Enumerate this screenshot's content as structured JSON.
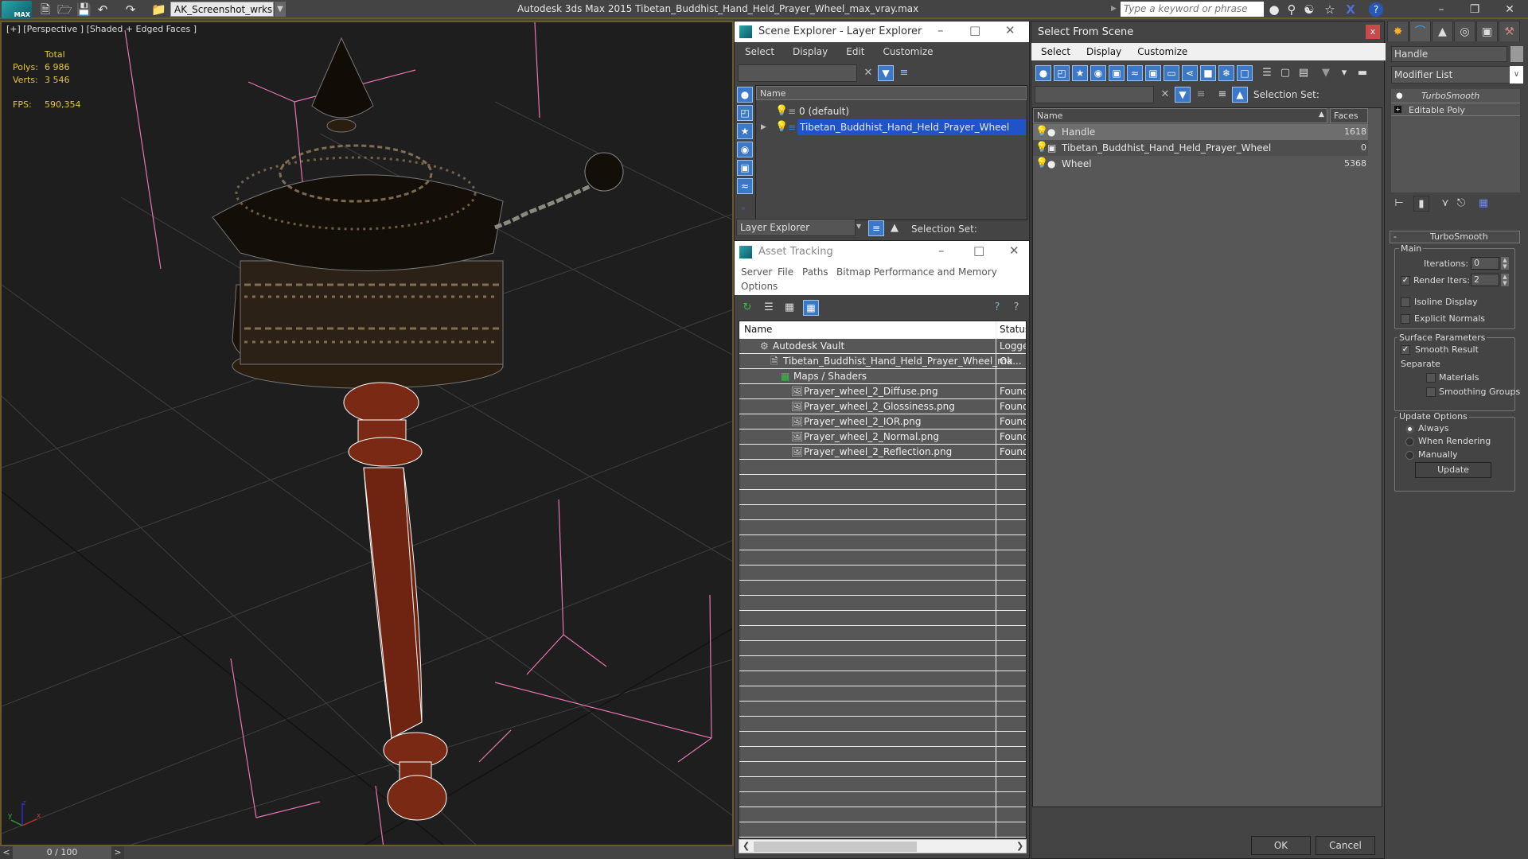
{
  "titlebar": {
    "logo_label": "MAX",
    "workspace": "AK_Screenshot_wrksp",
    "app_title": "Autodesk 3ds Max  2015    Tibetan_Buddhist_Hand_Held_Prayer_Wheel_max_vray.max",
    "search_placeholder": "Type a keyword or phrase",
    "icons": [
      "new-file",
      "open-file",
      "save-file",
      "undo",
      "redo",
      "project-folder",
      "binoculars",
      "key",
      "satellite",
      "star",
      "exchange-x",
      "help"
    ]
  },
  "viewport": {
    "label": "[+] [Perspective ] [Shaded + Edged Faces ]",
    "stats": {
      "header": "Total",
      "polys_label": "Polys:",
      "polys": "6 986",
      "verts_label": "Verts:",
      "verts": "3 546",
      "fps_label": "FPS:",
      "fps": "590,354"
    },
    "axis": {
      "x": "x",
      "y": "y",
      "z": "z"
    }
  },
  "timeline": {
    "prev": "<",
    "position": "0 / 100",
    "next": ">"
  },
  "scene_explorer": {
    "title": "Scene Explorer - Layer Explorer",
    "menu": [
      "Select",
      "Display",
      "Edit",
      "Customize"
    ],
    "column": "Name",
    "rows": [
      {
        "name": "0 (default)",
        "selected": false
      },
      {
        "name": "Tibetan_Buddhist_Hand_Held_Prayer_Wheel",
        "selected": true
      }
    ],
    "explorer_type": "Layer Explorer",
    "selection_set_label": "Selection Set:"
  },
  "asset_tracking": {
    "title": "Asset Tracking",
    "menu": [
      "Server",
      "File",
      "Paths",
      "Bitmap Performance and Memory",
      "Options"
    ],
    "columns": [
      "Name",
      "Status"
    ],
    "rows": [
      {
        "name": "Autodesk Vault",
        "status": "Logge",
        "indent": 1
      },
      {
        "name": "Tibetan_Buddhist_Hand_Held_Prayer_Wheel_ma...",
        "status": "Ok",
        "indent": 2
      },
      {
        "name": "Maps / Shaders",
        "status": "",
        "indent": 3
      },
      {
        "name": "Prayer_wheel_2_Diffuse.png",
        "status": "Found",
        "indent": 4
      },
      {
        "name": "Prayer_wheel_2_Glossiness.png",
        "status": "Found",
        "indent": 4
      },
      {
        "name": "Prayer_wheel_2_IOR.png",
        "status": "Found",
        "indent": 4
      },
      {
        "name": "Prayer_wheel_2_Normal.png",
        "status": "Found",
        "indent": 4
      },
      {
        "name": "Prayer_wheel_2_Reflection.png",
        "status": "Found",
        "indent": 4
      }
    ]
  },
  "select_from_scene": {
    "title": "Select From Scene",
    "close": "x",
    "menu": [
      "Select",
      "Display",
      "Customize"
    ],
    "selection_set_label": "Selection Set:",
    "columns": [
      "Name",
      "Faces"
    ],
    "rows": [
      {
        "name": "Handle",
        "faces": "1618",
        "selected": true
      },
      {
        "name": "Tibetan_Buddhist_Hand_Held_Prayer_Wheel",
        "faces": "0",
        "selected": false
      },
      {
        "name": "Wheel",
        "faces": "5368",
        "selected": false
      }
    ],
    "ok": "OK",
    "cancel": "Cancel"
  },
  "command_panel": {
    "object_name": "Handle",
    "modifier_list": "Modifier List",
    "stack": [
      {
        "name": "TurboSmooth"
      },
      {
        "name": "Editable Poly"
      }
    ],
    "rollout": {
      "title": "TurboSmooth",
      "collapse": "-",
      "main_group": "Main",
      "iterations_label": "Iterations:",
      "iterations": "0",
      "render_iters_label": "Render Iters:",
      "render_iters": "2",
      "render_iters_checked": true,
      "isoline_label": "Isoline Display",
      "isoline_checked": false,
      "explicit_normals_label": "Explicit Normals",
      "explicit_normals_checked": false,
      "surface_group": "Surface Parameters",
      "smooth_result_label": "Smooth Result",
      "smooth_result_checked": true,
      "separate_label": "Separate",
      "materials_label": "Materials",
      "smoothing_groups_label": "Smoothing Groups",
      "update_group": "Update Options",
      "always_label": "Always",
      "when_rendering_label": "When Rendering",
      "manually_label": "Manually",
      "update_selected": "Always",
      "update_button": "Update"
    }
  }
}
